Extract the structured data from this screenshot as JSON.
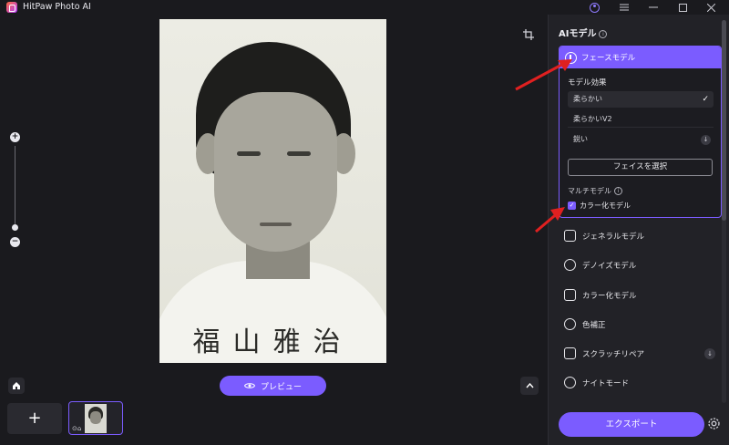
{
  "app": {
    "title": "HitPaw Photo AI"
  },
  "canvas": {
    "photo_name_text": "福山雅治"
  },
  "bottombar": {
    "preview_label": "プレビュー",
    "add_label": "+"
  },
  "panel": {
    "title": "AIモデル",
    "face_model": {
      "label": "フェースモデル",
      "effect_label": "モデル効果",
      "options": [
        {
          "label": "柔らかい",
          "selected": true
        },
        {
          "label": "柔らかいV2",
          "selected": false
        },
        {
          "label": "鋭い",
          "selected": false
        }
      ],
      "select_face_label": "フェイスを選択",
      "multi_label": "マルチモデル",
      "multi_option_label": "カラー化モデル"
    },
    "models": [
      {
        "label": "ジェネラルモデル",
        "icon": "image-icon"
      },
      {
        "label": "デノイズモデル",
        "icon": "denoise-icon"
      },
      {
        "label": "カラー化モデル",
        "icon": "colorize-icon"
      },
      {
        "label": "色補正",
        "icon": "color-correct-icon"
      },
      {
        "label": "スクラッチリペア",
        "icon": "scratch-repair-icon"
      },
      {
        "label": "ナイトモード",
        "icon": "night-mode-icon"
      }
    ],
    "export_label": "エクスポート"
  },
  "colors": {
    "accent": "#7b5cff",
    "background": "#1a1a1e",
    "panel": "#222227",
    "annotation": "#e02020"
  }
}
